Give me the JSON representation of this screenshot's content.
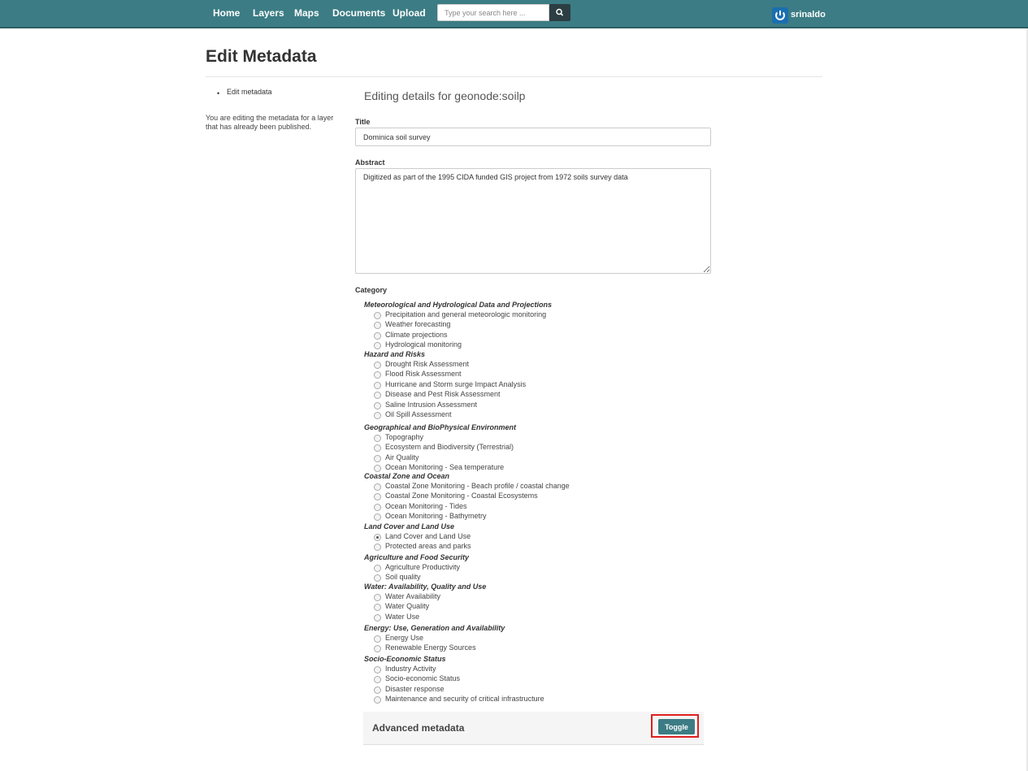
{
  "nav": {
    "items": [
      "Home",
      "Layers",
      "Maps",
      "Documents",
      "Upload"
    ],
    "search_placeholder": "Type your search here ...",
    "username": "srinaldo"
  },
  "page": {
    "title": "Edit Metadata",
    "sidebar_link": "Edit metadata",
    "sidebar_description": "You are editing the metadata for a layer that has already been published.",
    "editing_heading": "Editing details for geonode:soilp"
  },
  "form": {
    "title_label": "Title",
    "title_value": "Dominica soil survey",
    "abstract_label": "Abstract",
    "abstract_value": "Digitized as part of the 1995 CIDA funded GIS project from 1972 soils survey data",
    "category_label": "Category",
    "categories": [
      {
        "group": "Meteorological and Hydrological Data and Projections",
        "options": [
          "Precipitation and general meteorologic monitoring",
          "Weather forecasting",
          "Climate projections",
          "Hydrological monitoring"
        ]
      },
      {
        "group": "Hazard and Risks",
        "options": [
          "Drought Risk Assessment",
          "Flood Risk Assessment",
          "Hurricane and Storm surge Impact Analysis",
          "Disease and Pest Risk Assessment",
          "Saline Intrusion Assessment",
          "Oil Spill Assessment"
        ]
      },
      {
        "group": "Geographical and BioPhysical Environment",
        "options": [
          "Topography",
          "Ecosystem and Biodiversity (Terrestrial)",
          "Air Quality",
          "Ocean Monitoring - Sea temperature"
        ]
      },
      {
        "group": "Coastal Zone and Ocean",
        "options": [
          "Coastal Zone Monitoring - Beach profile / coastal change",
          "Coastal Zone Monitoring - Coastal Ecosystems",
          "Ocean Monitoring - Tides",
          "Ocean Monitoring - Bathymetry"
        ]
      },
      {
        "group": "Land Cover and Land Use",
        "options": [
          "Land Cover and Land Use",
          "Protected areas and parks"
        ]
      },
      {
        "group": "Agriculture and Food Security",
        "options": [
          "Agriculture Productivity",
          "Soil quality"
        ]
      },
      {
        "group": "Water: Availability, Quality and Use",
        "options": [
          "Water Availability",
          "Water Quality",
          "Water Use"
        ]
      },
      {
        "group": "Energy: Use, Generation and Availability",
        "options": [
          "Energy Use",
          "Renewable Energy Sources"
        ]
      },
      {
        "group": "Socio-Economic Status",
        "options": [
          "Industry Activity",
          "Socio-economic Status",
          "Disaster response",
          "Maintenance and security of critical infrastructure"
        ]
      }
    ],
    "selected_category": "Land Cover and Land Use"
  },
  "advanced": {
    "title": "Advanced metadata",
    "toggle_label": "Toggle"
  },
  "icons": {
    "search": "search-icon",
    "user": "power-icon"
  },
  "colors": {
    "navbar": "#3c7c84",
    "accent": "#3c7c84",
    "highlight": "#e02020"
  }
}
